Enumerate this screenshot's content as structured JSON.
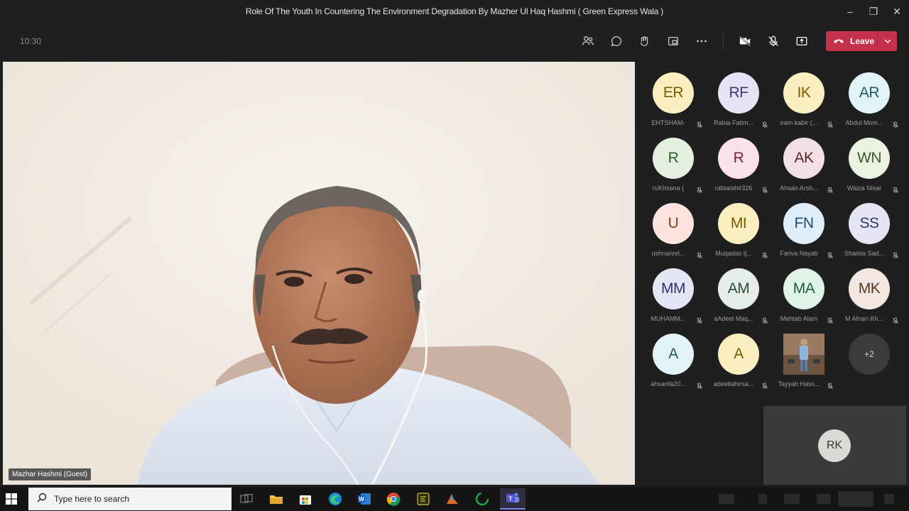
{
  "window": {
    "title": "Role Of The Youth In Countering The Environment Degradation By Mazher Ul Haq Hashmi ( Green Express Wala )"
  },
  "toolbar": {
    "timer": "10:30",
    "icons": [
      "people-icon",
      "chat-icon",
      "reactions-icon",
      "view-icon",
      "more-icon",
      "camera-off-icon",
      "mic-off-icon",
      "share-icon"
    ],
    "leave_label": "Leave",
    "leave_color": "#c4314b"
  },
  "main_video": {
    "name_label": "Mazhar Hashmi (Guest)"
  },
  "participants": [
    {
      "initials": "ER",
      "name": "EHTSHAM-",
      "bg": "#fbeec1",
      "fg": "#7a5a00"
    },
    {
      "initials": "RF",
      "name": "Rabia Fatim...",
      "bg": "#e6e3f6",
      "fg": "#3d3a72"
    },
    {
      "initials": "IK",
      "name": "iram kabir (...",
      "bg": "#fbeec1",
      "fg": "#7a5a00"
    },
    {
      "initials": "AR",
      "name": "Abdul Mom...",
      "bg": "#e1f3f6",
      "fg": "#1f5b66"
    },
    {
      "initials": "R",
      "name": "ruKhsana (",
      "bg": "#e5f1e0",
      "fg": "#2f5c24"
    },
    {
      "initials": "R",
      "name": "rabiatahir326",
      "bg": "#fbe1e8",
      "fg": "#7a2340"
    },
    {
      "initials": "AK",
      "name": "Ahsan Arsh...",
      "bg": "#f3e0e5",
      "fg": "#5a2432"
    },
    {
      "initials": "WN",
      "name": "Waiza Nisar",
      "bg": "#eaf2e2",
      "fg": "#3b5a28"
    },
    {
      "initials": "U",
      "name": "ushnanrel...",
      "bg": "#fde3dd",
      "fg": "#8a3a22"
    },
    {
      "initials": "MI",
      "name": "Muqadas Ij...",
      "bg": "#fbeec1",
      "fg": "#7a5a00"
    },
    {
      "initials": "FN",
      "name": "Fariva Nayab",
      "bg": "#dfeef8",
      "fg": "#1c4d70"
    },
    {
      "initials": "SS",
      "name": "Shaista Sad...",
      "bg": "#e6e5f4",
      "fg": "#3a3868"
    },
    {
      "initials": "MM",
      "name": "MUHAMM...",
      "bg": "#e4e5f5",
      "fg": "#2f3370"
    },
    {
      "initials": "AM",
      "name": "aAdeel Maq...",
      "bg": "#e6eeea",
      "fg": "#2d4a3c"
    },
    {
      "initials": "MA",
      "name": "Mehtab Alam",
      "bg": "#dff3e8",
      "fg": "#1f5c3c"
    },
    {
      "initials": "MK",
      "name": "M Afnan Kh...",
      "bg": "#f2e7e1",
      "fg": "#5a3426"
    },
    {
      "initials": "A",
      "name": "ahsanfa20...",
      "bg": "#e1f3f6",
      "fg": "#1f5b66"
    },
    {
      "initials": "A",
      "name": "adeeltahirsa...",
      "bg": "#fbeec1",
      "fg": "#7a5a00"
    },
    {
      "initials": "",
      "name": "Tayyab Hass...",
      "bg": "#8a6a52",
      "fg": "#ffffff",
      "photo": true
    },
    {
      "initials": "+2",
      "name": "",
      "bg": "#3b3b3b",
      "fg": "#d6d6d6",
      "more": true
    }
  ],
  "self_view": {
    "initials": "RK"
  },
  "taskbar": {
    "search_placeholder": "Type here to search",
    "apps": [
      "task-view-icon",
      "file-explorer-icon",
      "store-icon",
      "edge-icon",
      "word-icon",
      "chrome-icon",
      "app-icon",
      "app-icon-2",
      "app-icon-3",
      "teams-icon"
    ]
  }
}
